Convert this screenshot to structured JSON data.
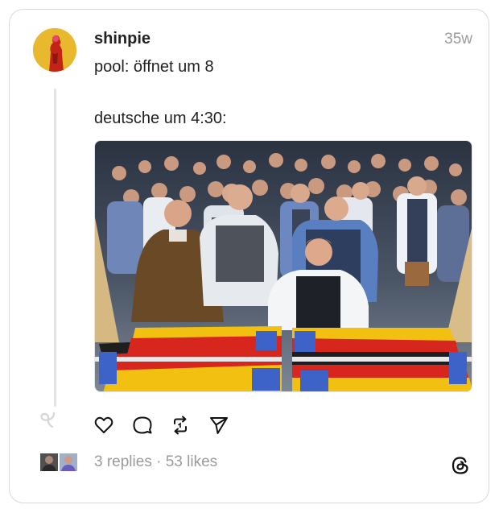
{
  "post": {
    "username": "shinpie",
    "time": "35w",
    "text_line_1": "pool: öffnet um 8",
    "text_line_2": "deutsche um 4:30:",
    "image_alt": "Crowd of men in traditional clothing running toward beer tables"
  },
  "actions": {
    "like_icon": "heart-icon",
    "reply_icon": "comment-icon",
    "repost_icon": "repost-icon",
    "share_icon": "send-icon"
  },
  "stats": {
    "replies": "3 replies",
    "separator": " · ",
    "likes": "53 likes"
  },
  "colors": {
    "avatar_bg": "#e8b92f",
    "muted_text": "#9b9b9b",
    "primary_text": "#222222",
    "border": "#d9d9d9",
    "flag_black": "#1e1e1e",
    "flag_red": "#d6261d",
    "flag_gold": "#f2c010"
  }
}
